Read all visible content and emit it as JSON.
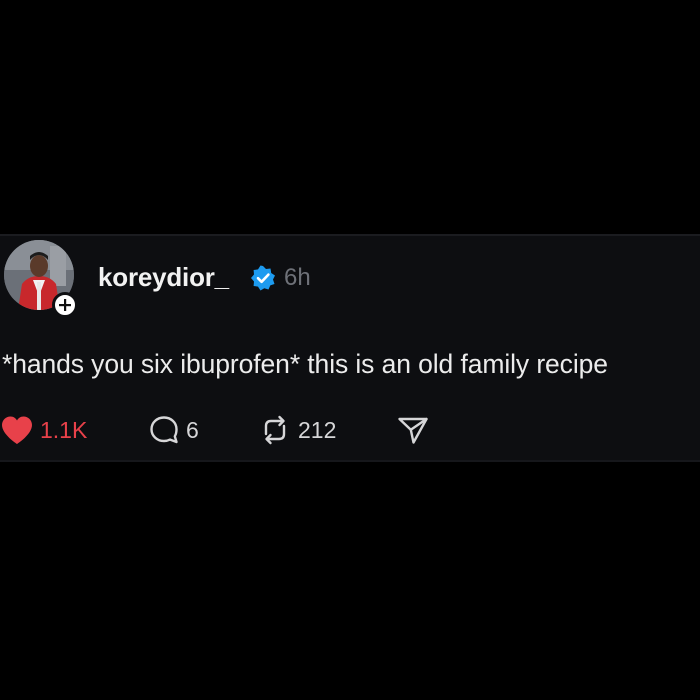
{
  "post": {
    "username": "koreydior_",
    "timestamp": "6h",
    "text": "*hands you six ibuprofen* this is an old family recipe",
    "verified": true,
    "likes": "1.1K",
    "replies": "6",
    "reposts": "212",
    "liked": true
  },
  "icons": {
    "avatar": "profile-photo",
    "follow": "plus-icon",
    "verified": "verified-badge-icon",
    "like": "heart-icon",
    "reply": "comment-icon",
    "repost": "repost-icon",
    "share": "send-icon"
  },
  "colors": {
    "background": "#000000",
    "card": "#0d0e11",
    "like_red": "#e8414a",
    "verified_blue": "#1d9bf0",
    "muted_gray": "#6e7178"
  }
}
